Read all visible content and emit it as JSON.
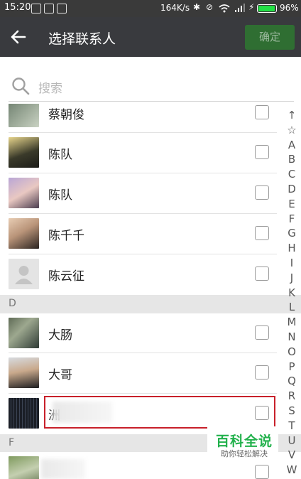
{
  "status_bar": {
    "time": "15:20",
    "speed": "164K/s",
    "battery": "96%",
    "battery_level": 0.96,
    "accent": "#22e045"
  },
  "header": {
    "back_icon": "arrow-left-icon",
    "title": "选择联系人",
    "confirm_label": "确定"
  },
  "search": {
    "icon": "search-icon",
    "placeholder": "搜索"
  },
  "contacts_top": [
    {
      "name": "蔡朝俊"
    },
    {
      "name": "陈队"
    },
    {
      "name": "陈队"
    },
    {
      "name": "陈千千"
    },
    {
      "name": "陈云征"
    }
  ],
  "section_d": {
    "letter": "D"
  },
  "contacts_d": [
    {
      "name": "大肠"
    },
    {
      "name": "大哥"
    },
    {
      "name": "洲"
    }
  ],
  "section_f": {
    "letter": "F"
  },
  "index_letters": [
    "↑",
    "☆",
    "A",
    "B",
    "C",
    "D",
    "E",
    "F",
    "G",
    "H",
    "I",
    "J",
    "K",
    "L",
    "M",
    "N",
    "O",
    "P",
    "Q",
    "R",
    "S",
    "T",
    "U",
    "V",
    "W"
  ],
  "watermark": {
    "title": "百科全说",
    "subtitle": "助你轻松解决"
  },
  "colors": {
    "header_bg": "#393a3e",
    "confirm_bg": "#2f6e32",
    "highlight": "#c8202a"
  }
}
